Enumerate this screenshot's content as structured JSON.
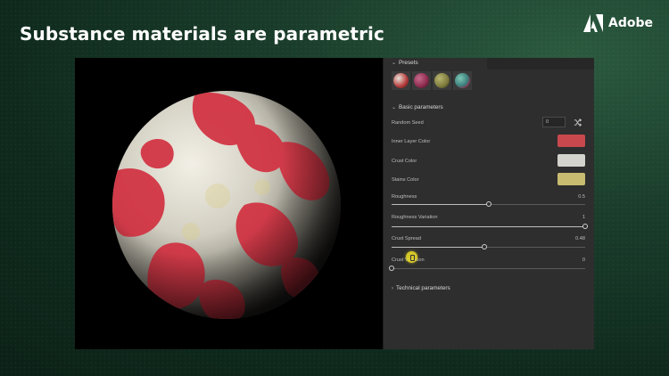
{
  "slide": {
    "title": "Substance materials are parametric"
  },
  "brand": {
    "name": "Adobe"
  },
  "panel": {
    "presets": {
      "label": "Presets",
      "items": [
        {
          "name": "preset-red",
          "color": "#b33a3a"
        },
        {
          "name": "preset-magenta",
          "color": "#8c2a4e"
        },
        {
          "name": "preset-olive",
          "color": "#7c7a3c"
        },
        {
          "name": "preset-teal",
          "color": "#3a7f7a"
        }
      ]
    },
    "basic": {
      "label": "Basic parameters",
      "random_seed": {
        "label": "Random Seed",
        "value": "0"
      },
      "inner_layer_color": {
        "label": "Inner Layer Color",
        "color": "#c8484e"
      },
      "crust_color": {
        "label": "Crust Color",
        "color": "#d4d2cc"
      },
      "stains_color": {
        "label": "Stains Color",
        "color": "#c8bc70"
      },
      "roughness": {
        "label": "Roughness",
        "value": "0.5",
        "fraction": 0.5
      },
      "roughness_variation": {
        "label": "Roughness Variation",
        "value": "1",
        "fraction": 1.0
      },
      "crust_spread": {
        "label": "Crust Spread",
        "value": "0.48",
        "fraction": 0.48
      },
      "crust_variation": {
        "label": "Crust Variation",
        "value": "0",
        "fraction": 0.0
      }
    },
    "technical": {
      "label": "Technical parameters"
    }
  }
}
